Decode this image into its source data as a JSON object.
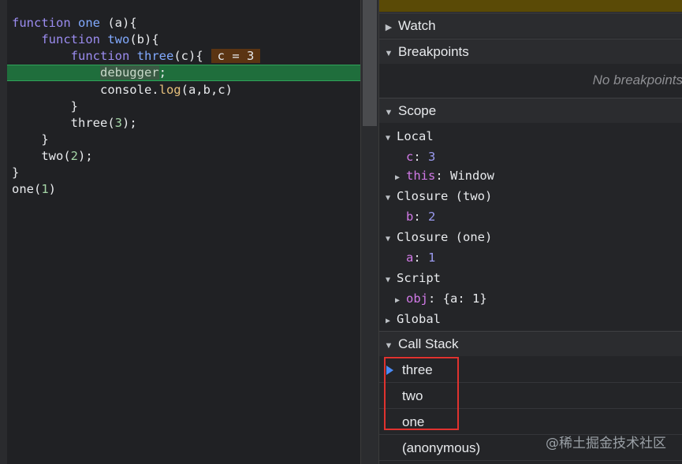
{
  "editor": {
    "lines": [
      {
        "id": "l1"
      },
      {
        "id": "l2"
      },
      {
        "id": "l3"
      },
      {
        "id": "l4"
      },
      {
        "id": "l5"
      },
      {
        "id": "l6"
      },
      {
        "id": "l7"
      },
      {
        "id": "l8"
      },
      {
        "id": "l9"
      },
      {
        "id": "l10"
      },
      {
        "id": "l11"
      }
    ],
    "kw_function": "function",
    "fn_one": "one",
    "param_a": "(a){",
    "fn_two": "two",
    "param_b": "(b){",
    "fn_three": "three",
    "param_c": "(c){",
    "inline_value": "c = 3",
    "debugger": "debugger",
    "semicolon": ";",
    "console": "console.",
    "log": "log",
    "log_args": "(a,b,c)",
    "close_brace": "}",
    "call_three": "three(",
    "call_three_arg": "3",
    "call_end": ");",
    "call_two": "two(",
    "call_two_arg": "2",
    "call_one": "one(",
    "call_one_arg": "1",
    "call_one_end": ")"
  },
  "sidebar": {
    "watch_label": "Watch",
    "breakpoints_label": "Breakpoints",
    "breakpoints_empty": "No breakpoints",
    "scope_label": "Scope",
    "scope": {
      "local_label": "Local",
      "local_c_key": "c",
      "local_c_val": "3",
      "local_this_key": "this",
      "local_this_val": "Window",
      "closure_two_label": "Closure (two)",
      "closure_two_key": "b",
      "closure_two_val": "2",
      "closure_one_label": "Closure (one)",
      "closure_one_key": "a",
      "closure_one_val": "1",
      "script_label": "Script",
      "script_obj_key": "obj",
      "script_obj_val": "{a: 1}",
      "global_label": "Global"
    },
    "callstack_label": "Call Stack",
    "callstack": [
      "three",
      "two",
      "one",
      "(anonymous)"
    ]
  },
  "watermark": "@稀土掘金技术社区",
  "colors": {
    "paused_bar": "#5a4a06",
    "current_line": "#1f6e3c",
    "highlight_box": "#e0322f",
    "current_frame_arrow": "#4c8bf5"
  }
}
